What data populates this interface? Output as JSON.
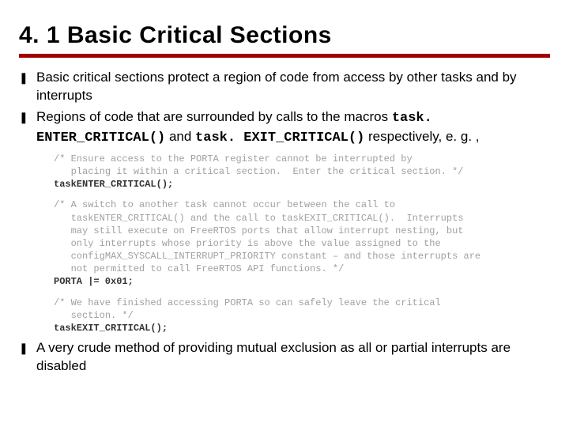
{
  "title": "4. 1 Basic Critical Sections",
  "bullets": {
    "b1": "Basic critical sections protect a region of code from access by other tasks and by interrupts",
    "b2_pre": "Regions of code that are surrounded by calls to the macros ",
    "b2_code1": "task. ENTER_CRITICAL()",
    "b2_mid": " and ",
    "b2_code2": "task. EXIT_CRITICAL()",
    "b2_post": "  respectively, e. g. ,",
    "b3": "A very crude method of providing mutual exclusion as all or partial interrupts are disabled"
  },
  "code": {
    "c1a": "/* Ensure access to the PORTA register cannot be interrupted by",
    "c1b": "   placing it within a critical section.  Enter the critical section. */",
    "c1c": "taskENTER_CRITICAL();",
    "c2a": "/* A switch to another task cannot occur between the call to",
    "c2b": "   taskENTER_CRITICAL() and the call to taskEXIT_CRITICAL().  Interrupts",
    "c2c": "   may still execute on FreeRTOS ports that allow interrupt nesting, but",
    "c2d": "   only interrupts whose priority is above the value assigned to the",
    "c2e": "   configMAX_SYSCALL_INTERRUPT_PRIORITY constant – and those interrupts are",
    "c2f": "   not permitted to call FreeRTOS API functions. */",
    "c2g": "PORTA |= 0x01;",
    "c3a": "/* We have finished accessing PORTA so can safely leave the critical",
    "c3b": "   section. */",
    "c3c": "taskEXIT_CRITICAL();"
  }
}
